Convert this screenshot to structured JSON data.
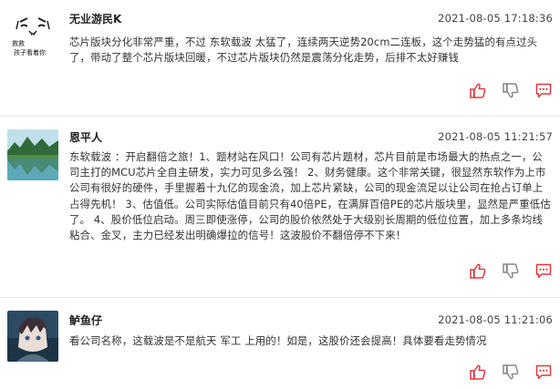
{
  "posts": [
    {
      "author": "无业游民K",
      "time": "2021-08-05 17:18:36",
      "avatar_text": [
        "救救",
        "孩子看着你"
      ],
      "text": "芯片版块分化非常严重，不过 东软载波 太猛了，连续两天逆势20cm二连板，这个走势猛的有点过头了，带动了整个芯片版块回暖，不过芯片版块仍然是震荡分化走势，后排不太好赚钱"
    },
    {
      "author": "恩平人",
      "time": "2021-08-05 11:21:57",
      "text": "东软载波 ：开启翻倍之旅！1、题材站在风口！公司有芯片题材，芯片目前是市场最大的热点之一，公司主打的MCU芯片全自主研发，实力可见多么强！ 2、财务健康。这个非常关键，很显然东软作为上市公司有很好的硬件，手里握着十九亿的现金流，加上芯片紧缺，公司的现金流足以让公司在抢占订单上占得先机！ 3、估值低。公司实际估值目前只有40倍PE，在满屏百倍PE的芯片版块里，显然是严重低估了。 4、股价低位启动。周三即使涨停，公司的股价依然处于大级别长周期的低位位置，加上多条均线粘合、金叉，主力已经发出明确爆拉的信号！这波股价不翻倍停不下来！"
    },
    {
      "author": "鲈鱼仔",
      "time": "2021-08-05 11:21:06",
      "text": "看公司名称，这载波是不是航天 军工 上用的！如是，这股价还会提高！具体要看走势情况"
    }
  ],
  "colors": {
    "like": "#e0383e",
    "dislike": "#888888",
    "comment": "#e0383e",
    "divider": "#e6e6e6"
  },
  "icons": [
    "thumbs-up-icon",
    "thumbs-down-icon",
    "comment-icon"
  ]
}
